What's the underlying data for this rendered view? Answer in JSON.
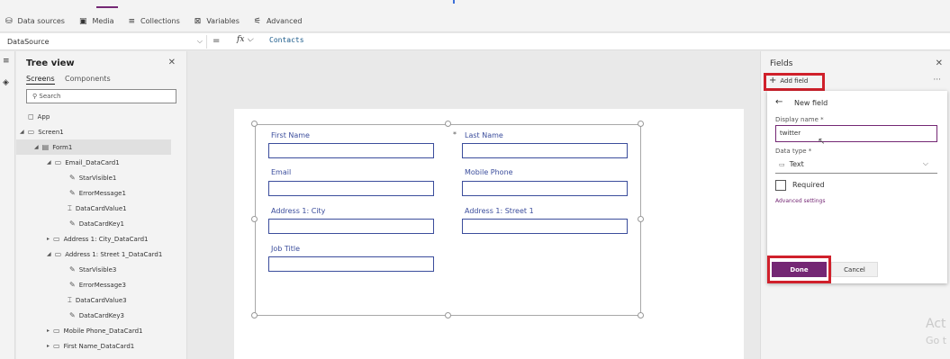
{
  "ribbon": {
    "items": [
      {
        "label": "Data sources",
        "icon": "database-icon",
        "glyph": "🗄"
      },
      {
        "label": "Media",
        "icon": "media-icon",
        "glyph": "🖼"
      },
      {
        "label": "Collections",
        "icon": "collections-icon",
        "glyph": "≡"
      },
      {
        "label": "Variables",
        "icon": "variables-icon",
        "glyph": "⊠"
      },
      {
        "label": "Advanced",
        "icon": "advanced-icon",
        "glyph": "⚟"
      }
    ]
  },
  "formula_bar": {
    "property": "DataSource",
    "equals": "=",
    "fx": "fx",
    "formula": "Contacts"
  },
  "tree_view": {
    "title": "Tree view",
    "tabs": [
      "Screens",
      "Components"
    ],
    "search_placeholder": "Search",
    "nodes": [
      {
        "label": "App",
        "icon": "app-icon",
        "level": 0
      },
      {
        "label": "Screen1",
        "icon": "screen-icon",
        "level": 0
      },
      {
        "label": "Form1",
        "icon": "form-icon",
        "level": 1
      },
      {
        "label": "Email_DataCard1",
        "icon": "datacard-icon",
        "level": 2
      },
      {
        "label": "StarVisible1",
        "icon": "edit-icon",
        "level": 3
      },
      {
        "label": "ErrorMessage1",
        "icon": "edit-icon",
        "level": 3
      },
      {
        "label": "DataCardValue1",
        "icon": "textinput-icon",
        "level": 3
      },
      {
        "label": "DataCardKey1",
        "icon": "edit-icon",
        "level": 3
      },
      {
        "label": "Address 1: City_DataCard1",
        "icon": "datacard-icon",
        "level": 2
      },
      {
        "label": "Address 1: Street 1_DataCard1",
        "icon": "datacard-icon",
        "level": 2
      },
      {
        "label": "StarVisible3",
        "icon": "edit-icon",
        "level": 3
      },
      {
        "label": "ErrorMessage3",
        "icon": "edit-icon",
        "level": 3
      },
      {
        "label": "DataCardValue3",
        "icon": "textinput-icon",
        "level": 3
      },
      {
        "label": "DataCardKey3",
        "icon": "edit-icon",
        "level": 3
      },
      {
        "label": "Mobile Phone_DataCard1",
        "icon": "datacard-icon",
        "level": 2
      },
      {
        "label": "First Name_DataCard1",
        "icon": "datacard-icon",
        "level": 2
      }
    ]
  },
  "form": {
    "fields": [
      {
        "label": "First Name"
      },
      {
        "label": "Last Name"
      },
      {
        "label": "Email"
      },
      {
        "label": "Mobile Phone"
      },
      {
        "label": "Address 1: City"
      },
      {
        "label": "Address 1: Street 1"
      },
      {
        "label": "Job Title"
      }
    ],
    "required_star": "*"
  },
  "fields_panel": {
    "title": "Fields",
    "add_field": "Add field",
    "more": "···",
    "new_field": {
      "title": "New field",
      "display_name_label": "Display name *",
      "display_name_value": "twitter",
      "data_type_label": "Data type *",
      "data_type_value": "Text",
      "required_label": "Required",
      "advanced_settings": "Advanced settings",
      "done": "Done",
      "cancel": "Cancel"
    }
  },
  "watermark": {
    "line1": "Act",
    "line2": "Go t"
  },
  "colors": {
    "accent": "#742774",
    "label_blue": "#3b4d9c",
    "highlight_red": "#d0202b"
  }
}
